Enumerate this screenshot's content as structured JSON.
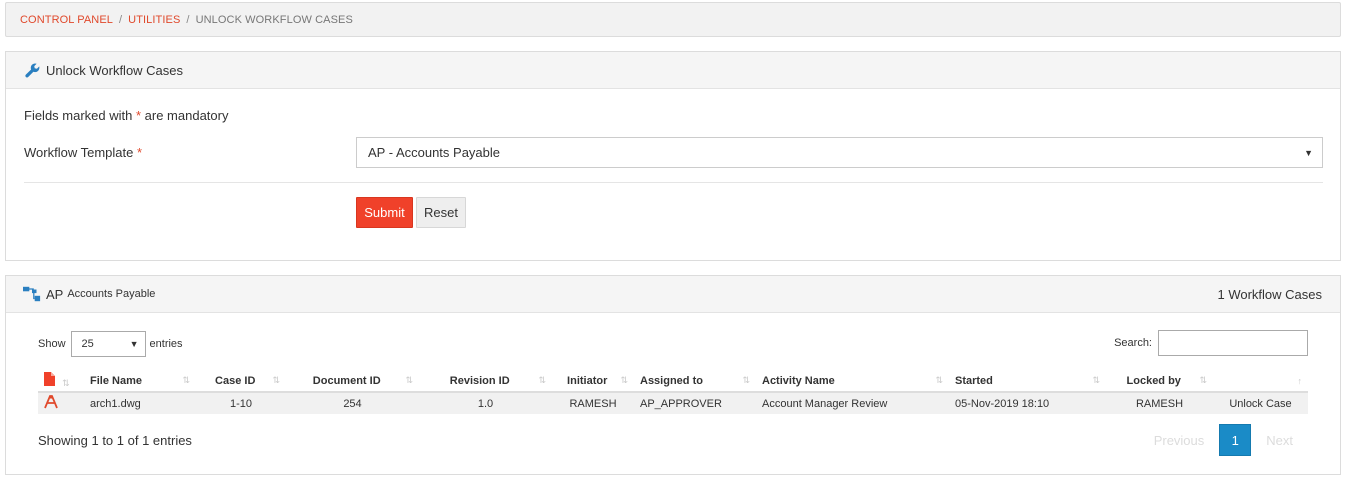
{
  "breadcrumb": {
    "items": [
      "CONTROL PANEL",
      "UTILITIES"
    ],
    "separator": "/",
    "current": "UNLOCK WORKFLOW CASES"
  },
  "form_panel": {
    "title": "Unlock Workflow Cases",
    "icon": "wrench-icon",
    "mandatory_prefix": "Fields marked with ",
    "mandatory_star": "*",
    "mandatory_suffix": " are mandatory",
    "template_label": "Workflow Template ",
    "template_star": "*",
    "template_value": "AP - Accounts Payable",
    "submit_label": "Submit",
    "reset_label": "Reset"
  },
  "table_panel": {
    "title_code": "AP",
    "title_name": "Accounts Payable",
    "icon": "workflow-icon",
    "case_count": "1 Workflow Cases",
    "show_label": "Show",
    "page_length": "25",
    "entries_label": "entries",
    "search_label": "Search:",
    "search_value": "",
    "columns": [
      "File Name",
      "Case ID",
      "Document ID",
      "Revision ID",
      "Initiator",
      "Assigned to",
      "Activity Name",
      "Started",
      "Locked by"
    ],
    "rows": [
      {
        "file_icon": "autocad-file-icon",
        "file_name": "arch1.dwg",
        "case_id": "1-10",
        "document_id": "254",
        "revision_id": "1.0",
        "initiator": "RAMESH",
        "assigned_to": "AP_APPROVER",
        "activity_name": "Account Manager Review",
        "started": "05-Nov-2019 18:10",
        "locked_by": "RAMESH",
        "action": "Unlock Case"
      }
    ],
    "info": "Showing 1 to 1 of 1 entries",
    "pager": {
      "previous": "Previous",
      "current": "1",
      "next": "Next"
    }
  },
  "colors": {
    "accent_red": "#e0492c",
    "link_blue": "#2a6fb0",
    "pager_blue": "#1a8bc7"
  }
}
